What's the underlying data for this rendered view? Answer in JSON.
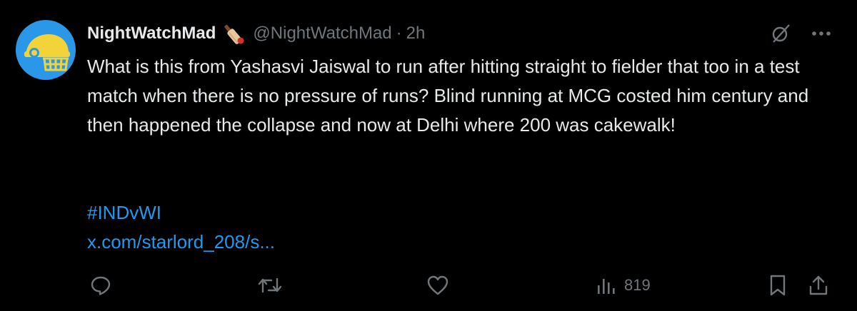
{
  "author": {
    "display_name": "NightWatchMad",
    "handle": "@NightWatchMad",
    "separator": "·",
    "time": "2h"
  },
  "tweet": {
    "text": "What is this from Yashasvi Jaiswal to run after hitting straight to fielder that too in a test match when there is no pressure of runs? Blind running at MCG costed him century and then happened the collapse and now at Delhi where 200 was cakewalk!",
    "hashtag": "#INDvWI",
    "link": "x.com/starlord_208/s..."
  },
  "metrics": {
    "views": "819"
  },
  "colors": {
    "background": "#000000",
    "text": "#e7e9ea",
    "muted": "#71767b",
    "link": "#1d9bf0",
    "avatar_bg": "#2a97e8",
    "helmet": "#f2d43a"
  },
  "icons": [
    "cricket-bat-icon",
    "grok-icon",
    "more-icon",
    "reply-icon",
    "retweet-icon",
    "like-icon",
    "views-icon",
    "bookmark-icon",
    "share-icon"
  ]
}
